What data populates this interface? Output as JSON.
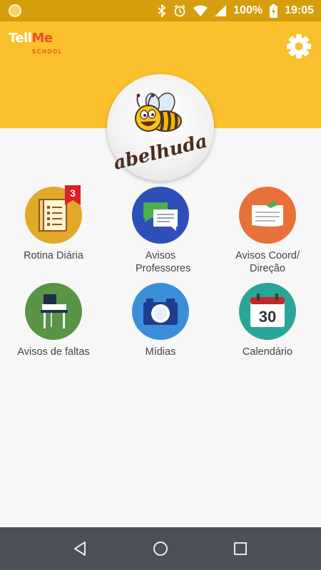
{
  "status_bar": {
    "battery_percent": "100%",
    "time": "19:05"
  },
  "header": {
    "logo_text_tell": "Tell",
    "logo_text_me": "Me",
    "logo_subtext": "SCHOOL",
    "settings_icon": "gear-icon",
    "background_color": "#fbc02d"
  },
  "avatar": {
    "school_name": "abelhuda"
  },
  "menu": {
    "items": [
      {
        "label": "Rotina Diária",
        "color": "#e1a82a",
        "icon": "notebook-icon",
        "badge": "3"
      },
      {
        "label": "Avisos Professores",
        "color": "#2f4fb8",
        "icon": "chat-bubbles-icon"
      },
      {
        "label": "Avisos Coord/ Direção",
        "color": "#e8713a",
        "icon": "paper-note-icon"
      },
      {
        "label": "Avisos de faltas",
        "color": "#5a9446",
        "icon": "school-desk-icon"
      },
      {
        "label": "Mídias",
        "color": "#3b8fd9",
        "icon": "camera-icon"
      },
      {
        "label": "Calendário",
        "color": "#2aa59a",
        "icon": "calendar-icon",
        "calendar_day": "30"
      }
    ]
  },
  "nav": {
    "back_icon": "back-triangle-icon",
    "home_icon": "home-circle-icon",
    "recents_icon": "recents-square-icon"
  }
}
